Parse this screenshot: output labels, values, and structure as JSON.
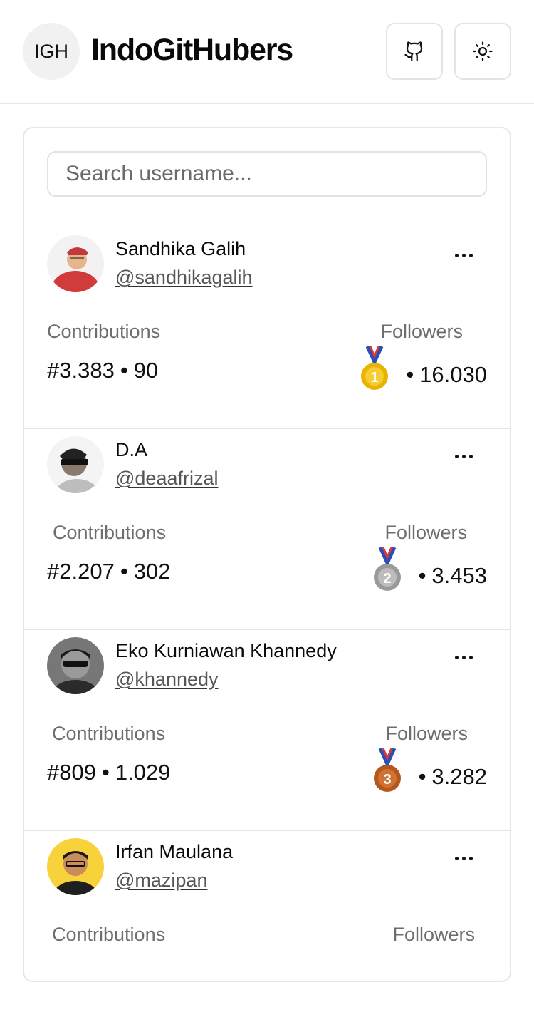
{
  "header": {
    "logo_text": "IGH",
    "title": "IndoGitHubers",
    "github_icon": "github-icon",
    "theme_icon": "sun-icon"
  },
  "search": {
    "placeholder": "Search username...",
    "value": ""
  },
  "labels": {
    "contributions": "Contributions",
    "followers": "Followers",
    "separator": "•"
  },
  "users": [
    {
      "name": "Sandhika Galih",
      "handle": "@sandhikagalih",
      "contrib_rank": "#3.383",
      "contrib_count": "90",
      "medal_rank": "1",
      "medal_color": "#e8b400",
      "followers": "16.030",
      "avatar_bg": "#f2f2f2",
      "avatar_accent": "#d23b3b"
    },
    {
      "name": "D.A",
      "handle": "@deaafrizal",
      "contrib_rank": "#2.207",
      "contrib_count": "302",
      "medal_rank": "2",
      "medal_color": "#9a9a9a",
      "followers": "3.453",
      "avatar_bg": "#f4f4f4",
      "avatar_accent": "#2a2a2a"
    },
    {
      "name": "Eko Kurniawan Khannedy",
      "handle": "@khannedy",
      "contrib_rank": "#809",
      "contrib_count": "1.029",
      "medal_rank": "3",
      "medal_color": "#b5561c",
      "followers": "3.282",
      "avatar_bg": "#777777",
      "avatar_accent": "#1f1f1f"
    },
    {
      "name": "Irfan Maulana",
      "handle": "@mazipan",
      "contrib_rank": "",
      "contrib_count": "",
      "medal_rank": "",
      "medal_color": "",
      "followers": "",
      "avatar_bg": "#f7d23a",
      "avatar_accent": "#1f1f1f"
    }
  ]
}
